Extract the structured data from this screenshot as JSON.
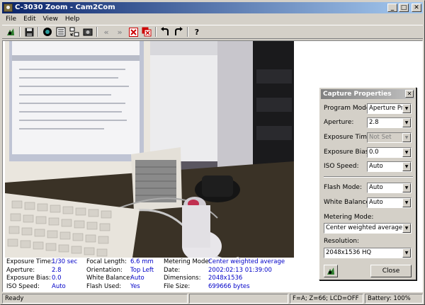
{
  "window": {
    "title": "C-3030 Zoom - Cam2Com"
  },
  "menu": [
    "File",
    "Edit",
    "View",
    "Help"
  ],
  "toolbar_icons": [
    "camera-capture-icon",
    "save-icon",
    "connect-icon",
    "properties-icon",
    "transfer-icon",
    "photo-icon",
    "previous-icon",
    "next-icon",
    "delete-icon",
    "delete-all-icon",
    "rotate-left-icon",
    "rotate-right-icon",
    "help-icon"
  ],
  "info": {
    "col1": [
      {
        "label": "Exposure Time:",
        "value": "1/30 sec"
      },
      {
        "label": "Aperture:",
        "value": "2.8"
      },
      {
        "label": "Exposure Bias:",
        "value": "0.0"
      },
      {
        "label": "ISO Speed:",
        "value": "Auto"
      }
    ],
    "col2": [
      {
        "label": "Focal Length:",
        "value": "6.6  mm"
      },
      {
        "label": "Orientation:",
        "value": "Top Left"
      },
      {
        "label": "White Balance:",
        "value": "Auto"
      },
      {
        "label": "Flash Used:",
        "value": "Yes"
      }
    ],
    "col3": [
      {
        "label": "Metering Mode:",
        "value": "Center weighted average"
      },
      {
        "label": "Date:",
        "value": "2002:02:13 01:39:00"
      },
      {
        "label": "Dimensions:",
        "value": "2048x1536"
      },
      {
        "label": "File Size:",
        "value": "699666 bytes"
      }
    ]
  },
  "dialog": {
    "title": "Capture Properties",
    "program_mode": {
      "label": "Program Mode:",
      "value": "Aperture Pric"
    },
    "aperture": {
      "label": "Aperture:",
      "value": "2.8"
    },
    "exposure_time": {
      "label": "Exposure Time:",
      "value": "Not Set"
    },
    "exposure_bias": {
      "label": "Exposure Bias:",
      "value": "0.0"
    },
    "iso_speed": {
      "label": "ISO Speed:",
      "value": "Auto"
    },
    "flash_mode": {
      "label": "Flash Mode:",
      "value": "Auto"
    },
    "white_balance": {
      "label": "White Balance:",
      "value": "Auto"
    },
    "metering_mode": {
      "label": "Metering Mode:",
      "value": "Center weighted average"
    },
    "resolution": {
      "label": "Resolution:",
      "value": "2048x1536 HQ"
    },
    "close_label": "Close"
  },
  "status": {
    "ready": "Ready",
    "camera_state": "F=A; Z=66; LCD=OFF",
    "battery": "Battery: 100%"
  }
}
